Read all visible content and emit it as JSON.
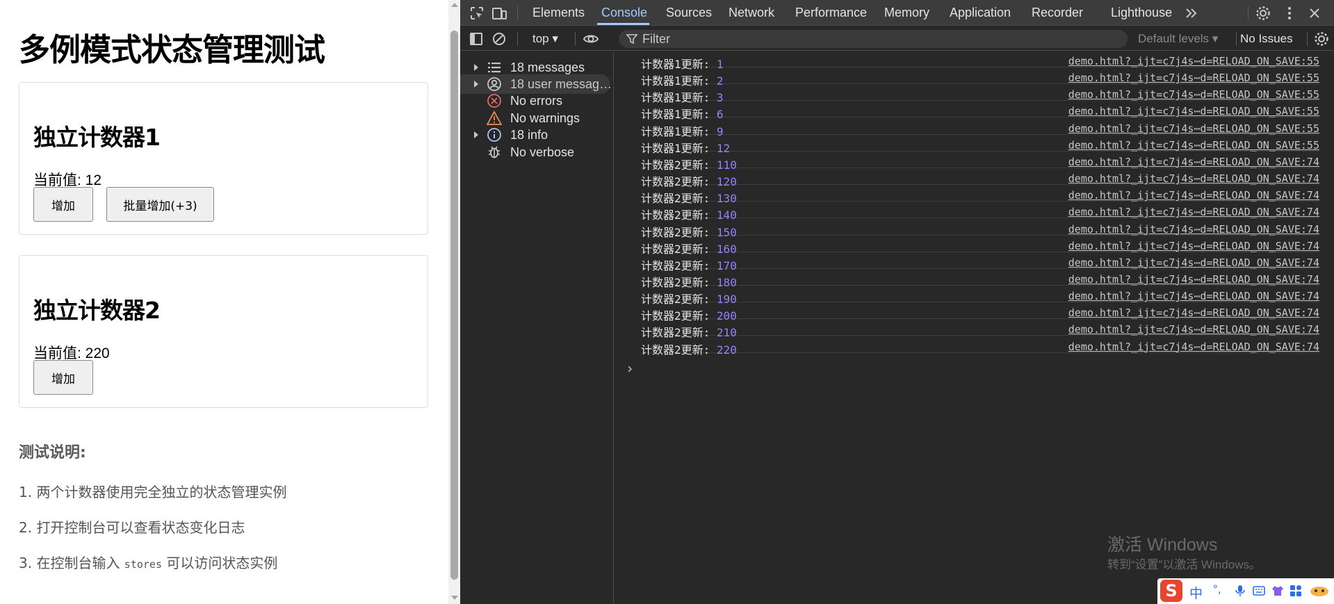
{
  "page": {
    "title": "多例模式状态管理测试",
    "counter1": {
      "heading": "独立计数器1",
      "value_text": "当前值: 12",
      "increment_label": "增加",
      "batch_label": "批量增加(+3)"
    },
    "counter2": {
      "heading": "独立计数器2",
      "value_text": "当前值: 220",
      "increment_label": "增加"
    },
    "notes_title": "测试说明:",
    "note1": "1. 两个计数器使用完全独立的状态管理实例",
    "note2": "2. 打开控制台可以查看状态变化日志",
    "note3_pre": "3. 在控制台输入 ",
    "note3_code": "stores",
    "note3_post": " 可以访问状态实例"
  },
  "devtools": {
    "tabs": [
      "Elements",
      "Console",
      "Sources",
      "Network",
      "Performance",
      "Memory",
      "Application",
      "Recorder",
      "Lighthouse"
    ],
    "active_tab": "Console",
    "context": "top ▾",
    "filter_placeholder": "Filter",
    "levels": "Default levels ▾",
    "issues": "No Issues",
    "sidebar": [
      {
        "label": "18 messages",
        "icon": "list-icon",
        "expandable": true
      },
      {
        "label": "18 user messag…",
        "icon": "user-icon",
        "expandable": true,
        "selected": true
      },
      {
        "label": "No errors",
        "icon": "error-icon",
        "expandable": false
      },
      {
        "label": "No warnings",
        "icon": "warning-icon",
        "expandable": false
      },
      {
        "label": "18 info",
        "icon": "info-icon",
        "expandable": true
      },
      {
        "label": "No verbose",
        "icon": "bug-icon",
        "expandable": false
      }
    ],
    "log_source_1": "demo.html?_ijt=c7j4s⋯d=RELOAD_ON_SAVE:55",
    "log_source_2": "demo.html?_ijt=c7j4s⋯d=RELOAD_ON_SAVE:74",
    "logs": [
      {
        "label": "计数器1更新:",
        "value": "1",
        "src": 1
      },
      {
        "label": "计数器1更新:",
        "value": "2",
        "src": 1
      },
      {
        "label": "计数器1更新:",
        "value": "3",
        "src": 1
      },
      {
        "label": "计数器1更新:",
        "value": "6",
        "src": 1
      },
      {
        "label": "计数器1更新:",
        "value": "9",
        "src": 1
      },
      {
        "label": "计数器1更新:",
        "value": "12",
        "src": 1
      },
      {
        "label": "计数器2更新:",
        "value": "110",
        "src": 2
      },
      {
        "label": "计数器2更新:",
        "value": "120",
        "src": 2
      },
      {
        "label": "计数器2更新:",
        "value": "130",
        "src": 2
      },
      {
        "label": "计数器2更新:",
        "value": "140",
        "src": 2
      },
      {
        "label": "计数器2更新:",
        "value": "150",
        "src": 2
      },
      {
        "label": "计数器2更新:",
        "value": "160",
        "src": 2
      },
      {
        "label": "计数器2更新:",
        "value": "170",
        "src": 2
      },
      {
        "label": "计数器2更新:",
        "value": "180",
        "src": 2
      },
      {
        "label": "计数器2更新:",
        "value": "190",
        "src": 2
      },
      {
        "label": "计数器2更新:",
        "value": "200",
        "src": 2
      },
      {
        "label": "计数器2更新:",
        "value": "210",
        "src": 2
      },
      {
        "label": "计数器2更新:",
        "value": "220",
        "src": 2
      }
    ],
    "prompt": "›"
  },
  "watermark": {
    "line1": "激活 Windows",
    "line2": "转到“设置”以激活 Windows。"
  },
  "ime": {
    "logo": "S",
    "lang": "中",
    "punct": "°,"
  },
  "colors": {
    "accent": "#a8c7fa",
    "number": "#9980ff",
    "error": "#e46962",
    "warning": "#f28b54",
    "info": "#a8c7fa"
  }
}
